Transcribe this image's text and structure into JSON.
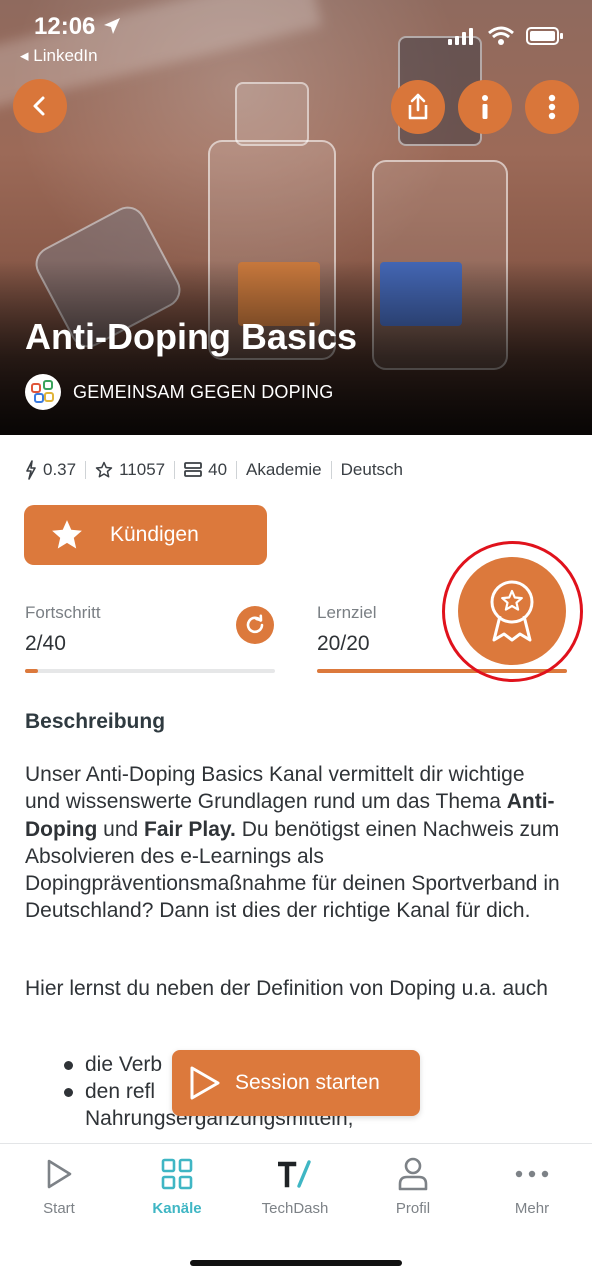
{
  "status_bar": {
    "time": "12:06",
    "back_app": "LinkedIn"
  },
  "hero": {
    "title": "Anti-Doping Basics",
    "org_name": "GEMEINSAM GEGEN DOPING",
    "buttons": [
      "back-icon",
      "share-icon",
      "info-icon",
      "more-vertical-icon"
    ]
  },
  "stats": {
    "price": "0.37",
    "rating_count": "11057",
    "lessons": "40",
    "category": "Akademie",
    "language": "Deutsch"
  },
  "subscribe": {
    "label": "Kündigen"
  },
  "progress": {
    "label": "Fortschritt",
    "value": "2/40",
    "fraction": 0.05
  },
  "goal": {
    "label": "Lernziel",
    "value": "20/20",
    "fraction": 1.0
  },
  "description": {
    "heading": "Beschreibung",
    "p1_a": "Unser Anti-Doping Basics Kanal vermittelt dir wichtige und wissenswerte Grundlagen rund um das Thema ",
    "p1_b1": "Anti-Doping",
    "p1_c": " und ",
    "p1_b2": "Fair Play.",
    "p1_d": " Du benötigst einen Nachweis zum Absolvieren des e-Learnings als Dopingpräventionsmaßnahme für deinen Sportverband in Deutschland? Dann ist dies der richtige Kanal für dich.",
    "p2": "Hier lernst du neben der Definition von Doping u.a. auch",
    "bullets": [
      "die Verb",
      "den refl",
      "Nahrungsergänzungsmitteln,"
    ]
  },
  "session_button": {
    "label": "Session starten"
  },
  "tabs": [
    {
      "label": "Start",
      "icon": "play-outline-icon"
    },
    {
      "label": "Kanäle",
      "icon": "grid-icon",
      "active": true
    },
    {
      "label": "TechDash",
      "icon": "techdash-icon"
    },
    {
      "label": "Profil",
      "icon": "person-icon"
    },
    {
      "label": "Mehr",
      "icon": "more-horizontal-icon"
    }
  ],
  "colors": {
    "accent": "#dc793c",
    "active_tab": "#3fb6c4",
    "highlight_ring": "#e0121c"
  }
}
